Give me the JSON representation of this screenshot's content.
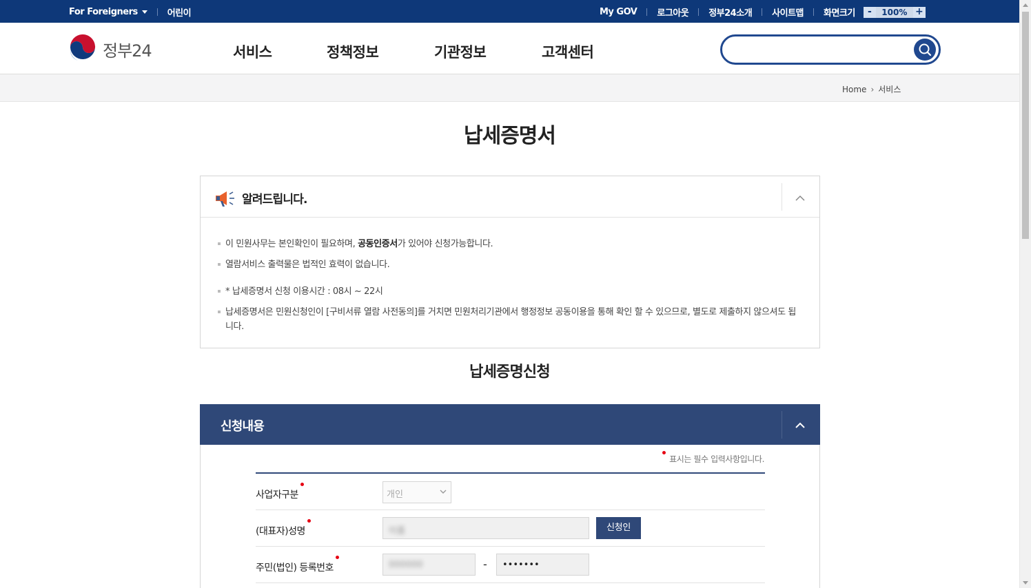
{
  "topbar": {
    "left": [
      {
        "label": "For Foreigners",
        "has_dropdown": true
      },
      {
        "label": "어린이"
      }
    ],
    "right": [
      "My GOV",
      "로그아웃",
      "정부24소개",
      "사이트맵",
      "화면크기"
    ],
    "zoom": {
      "minus": "-",
      "value": "100%",
      "plus": "+"
    }
  },
  "header": {
    "logo_text": "정부24",
    "nav": [
      "서비스",
      "정책정보",
      "기관정보",
      "고객센터"
    ],
    "search": {
      "value": "",
      "placeholder": ""
    }
  },
  "breadcrumb": {
    "home": "Home",
    "current": "서비스"
  },
  "page_title": "납세증명서",
  "notice": {
    "title": "알려드립니다.",
    "items": [
      {
        "before": "이 민원사무는 본인확인이 필요하며, ",
        "bold": "공동인증서",
        "after": "가 있어야 신청가능합니다."
      },
      {
        "text": "열람서비스 출력물은 법적인 효력이 없습니다."
      },
      {
        "text": "* 납세증명서 신청 이용시간 : 08시 ~ 22시"
      },
      {
        "text": "납세증명서은 민원신청인이 [구비서류 열람 사전동의]를 거치면 민원처리기관에서 행정정보 공동이용을 통해 확인 할 수 있으므로, 별도로 제출하지 않으셔도 됩니다."
      }
    ]
  },
  "subtitle": "납세증명신청",
  "form": {
    "section_title": "신청내용",
    "required_note": "표시는 필수 입력사항입니다.",
    "rows": {
      "business_type": {
        "label": "사업자구분",
        "value": "개인"
      },
      "name": {
        "label": "(대표자)성명",
        "value": "이름",
        "button": "신청인"
      },
      "reg_number": {
        "label": "주민(법인) 등록번호",
        "first": "000000",
        "separator": "-",
        "second": "•••••••"
      }
    }
  },
  "colors": {
    "topbar": "#0e3879",
    "accent": "#20488f",
    "section_header": "#2f4878",
    "required_dot": "#e60012"
  },
  "icons": [
    "chevron-down-icon",
    "search-icon",
    "megaphone-icon",
    "chevron-up-icon"
  ]
}
